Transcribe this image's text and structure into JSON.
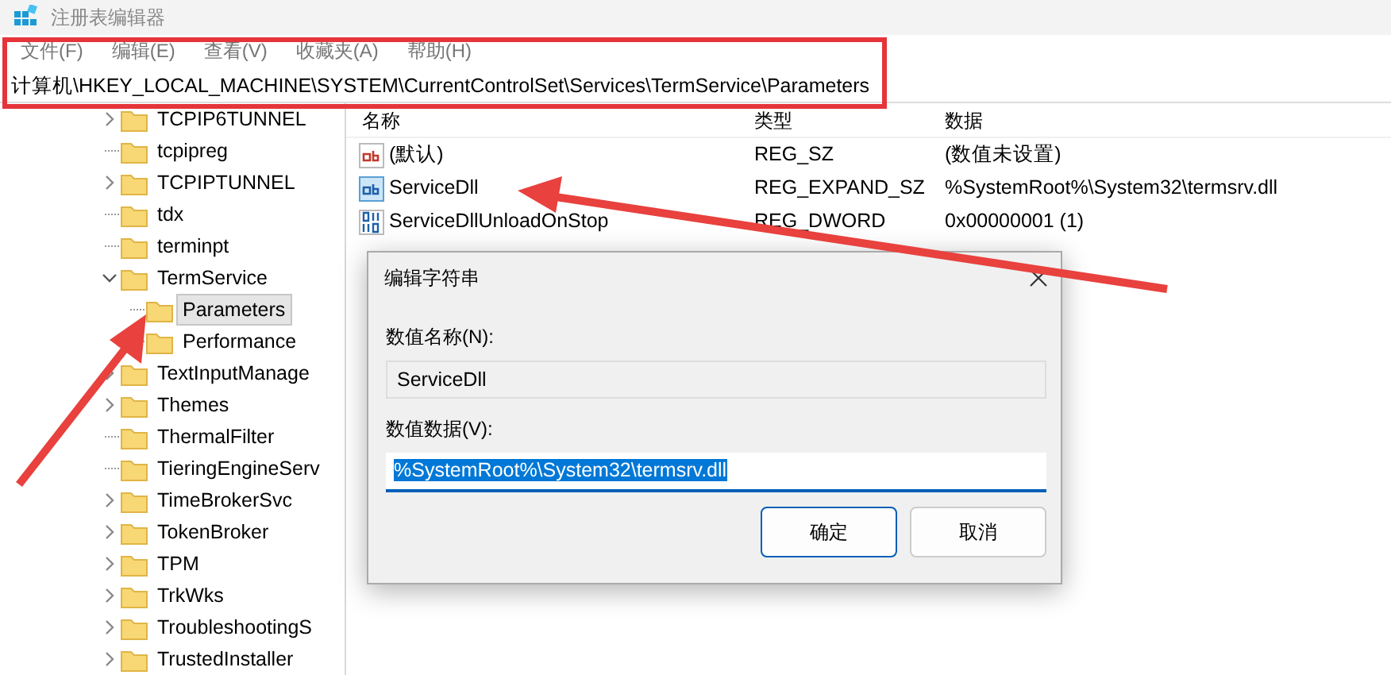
{
  "window": {
    "title": "注册表编辑器"
  },
  "menu": [
    {
      "label": "文件(F)"
    },
    {
      "label": "编辑(E)"
    },
    {
      "label": "查看(V)"
    },
    {
      "label": "收藏夹(A)"
    },
    {
      "label": "帮助(H)"
    }
  ],
  "address": "计算机\\HKEY_LOCAL_MACHINE\\SYSTEM\\CurrentControlSet\\Services\\TermService\\Parameters",
  "tree": [
    {
      "label": "TCPIP6TUNNEL",
      "kind": "collapsed",
      "selected": false
    },
    {
      "label": "tcpipreg",
      "kind": "leaf",
      "selected": false
    },
    {
      "label": "TCPIPTUNNEL",
      "kind": "collapsed",
      "selected": false
    },
    {
      "label": "tdx",
      "kind": "leaf",
      "selected": false
    },
    {
      "label": "terminpt",
      "kind": "leaf",
      "selected": false
    },
    {
      "label": "TermService",
      "kind": "expanded",
      "selected": false,
      "children": [
        {
          "label": "Parameters",
          "kind": "leaf",
          "selected": true
        },
        {
          "label": "Performance",
          "kind": "leaf",
          "selected": false
        }
      ]
    },
    {
      "label": "TextInputManage",
      "kind": "collapsed",
      "selected": false
    },
    {
      "label": "Themes",
      "kind": "collapsed",
      "selected": false
    },
    {
      "label": "ThermalFilter",
      "kind": "leaf",
      "selected": false
    },
    {
      "label": "TieringEngineServ",
      "kind": "leaf",
      "selected": false
    },
    {
      "label": "TimeBrokerSvc",
      "kind": "collapsed",
      "selected": false
    },
    {
      "label": "TokenBroker",
      "kind": "collapsed",
      "selected": false
    },
    {
      "label": "TPM",
      "kind": "collapsed",
      "selected": false
    },
    {
      "label": "TrkWks",
      "kind": "collapsed",
      "selected": false
    },
    {
      "label": "TroubleshootingS",
      "kind": "collapsed",
      "selected": false
    },
    {
      "label": "TrustedInstaller",
      "kind": "collapsed",
      "selected": false
    }
  ],
  "values": {
    "columns": [
      "名称",
      "类型",
      "数据"
    ],
    "rows": [
      {
        "kind": "string",
        "selected": false,
        "name": "(默认)",
        "type": "REG_SZ",
        "data": "(数值未设置)"
      },
      {
        "kind": "string",
        "selected": true,
        "name": "ServiceDll",
        "type": "REG_EXPAND_SZ",
        "data": "%SystemRoot%\\System32\\termsrv.dll"
      },
      {
        "kind": "binary",
        "selected": false,
        "name": "ServiceDllUnloadOnStop",
        "type": "REG_DWORD",
        "data": "0x00000001 (1)"
      }
    ]
  },
  "dialog": {
    "title": "编辑字符串",
    "name_label": "数值名称(N):",
    "name_value": "ServiceDll",
    "data_label": "数值数据(V):",
    "data_value": "%SystemRoot%\\System32\\termsrv.dll",
    "data_text_selected": true,
    "buttons": [
      {
        "label": "确定",
        "default": true
      },
      {
        "label": "取消",
        "default": false
      }
    ]
  }
}
